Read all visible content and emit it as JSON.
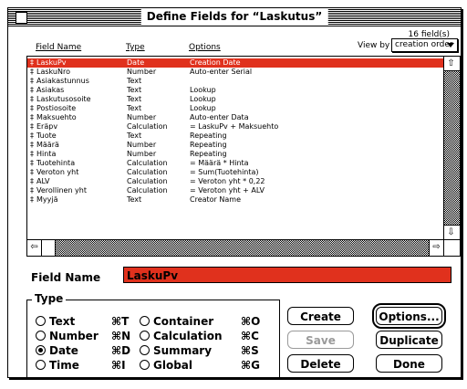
{
  "window": {
    "title": "Define Fields for “Laskutus”"
  },
  "list": {
    "count": "16 field(s)",
    "headers": {
      "name": "Field Name",
      "type": "Type",
      "options": "Options"
    },
    "view_by_label": "View by",
    "view_by_value": "creation order",
    "rows": [
      {
        "name": "LaskuPv",
        "type": "Date",
        "options": "Creation Date",
        "selected": true
      },
      {
        "name": "LaskuNro",
        "type": "Number",
        "options": "Auto-enter Serial"
      },
      {
        "name": "Asiakastunnus",
        "type": "Text",
        "options": ""
      },
      {
        "name": "Asiakas",
        "type": "Text",
        "options": "Lookup"
      },
      {
        "name": "Laskutusosoite",
        "type": "Text",
        "options": "Lookup"
      },
      {
        "name": "Postiosoite",
        "type": "Text",
        "options": "Lookup"
      },
      {
        "name": "Maksuehto",
        "type": "Number",
        "options": "Auto-enter Data"
      },
      {
        "name": "Eräpv",
        "type": "Calculation",
        "options": "= LaskuPv + Maksuehto"
      },
      {
        "name": "Tuote",
        "type": "Text",
        "options": "Repeating"
      },
      {
        "name": "Määrä",
        "type": "Number",
        "options": "Repeating"
      },
      {
        "name": "Hinta",
        "type": "Number",
        "options": "Repeating"
      },
      {
        "name": "Tuotehinta",
        "type": "Calculation",
        "options": "= Määrä * Hinta"
      },
      {
        "name": "Veroton yht",
        "type": "Calculation",
        "options": "= Sum(Tuotehinta)"
      },
      {
        "name": "ALV",
        "type": "Calculation",
        "options": "= Veroton yht * 0,22"
      },
      {
        "name": "Verollinen yht",
        "type": "Calculation",
        "options": "= Veroton yht + ALV"
      },
      {
        "name": "Myyjä",
        "type": "Text",
        "options": "Creator Name"
      }
    ],
    "row_marker": "‡"
  },
  "field_name": {
    "label": "Field Name",
    "value": "LaskuPv"
  },
  "type_group": {
    "legend": "Type",
    "options": [
      {
        "label": "Text",
        "key": "⌘T",
        "checked": false
      },
      {
        "label": "Number",
        "key": "⌘N",
        "checked": false
      },
      {
        "label": "Date",
        "key": "⌘D",
        "checked": true
      },
      {
        "label": "Time",
        "key": "⌘I",
        "checked": false
      },
      {
        "label": "Container",
        "key": "⌘O",
        "checked": false
      },
      {
        "label": "Calculation",
        "key": "⌘C",
        "checked": false
      },
      {
        "label": "Summary",
        "key": "⌘S",
        "checked": false
      },
      {
        "label": "Global",
        "key": "⌘G",
        "checked": false
      }
    ]
  },
  "buttons": {
    "create": "Create",
    "options": "Options...",
    "save": "Save",
    "duplicate": "Duplicate",
    "delete": "Delete",
    "done": "Done"
  },
  "colors": {
    "selection": "#e0311d"
  }
}
